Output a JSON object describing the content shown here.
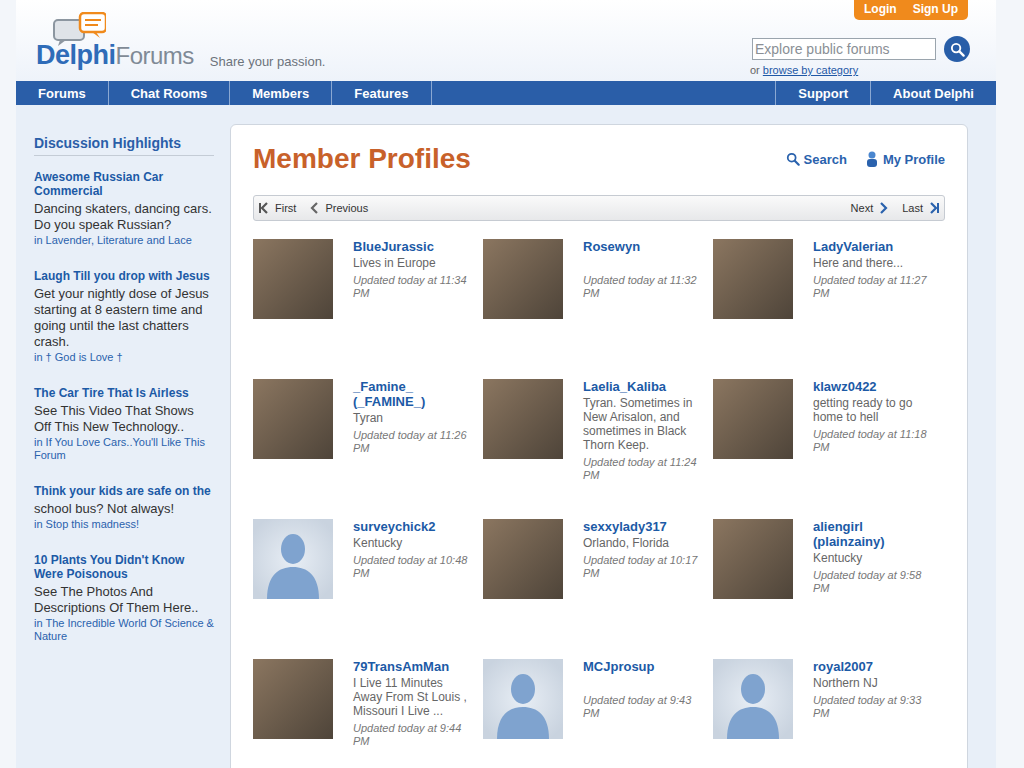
{
  "header": {
    "logo": {
      "first": "Delphi",
      "second": "Forums"
    },
    "tagline": "Share your passion.",
    "account_buttons": [
      "Login",
      "Sign Up"
    ],
    "search": {
      "placeholder": "Explore public forums",
      "alt_prefix": "or",
      "alt_link": "browse by category"
    }
  },
  "nav": {
    "left": [
      "Forums",
      "Chat Rooms",
      "Members",
      "Features"
    ],
    "right": [
      "Support",
      "About Delphi"
    ]
  },
  "sidebar": {
    "title": "Discussion Highlights",
    "items": [
      {
        "title": "Awesome Russian Car Commercial",
        "text": "Dancing skaters, dancing cars. Do you speak Russian?",
        "forum": "in Lavender, Literature and Lace"
      },
      {
        "title": "Laugh Till you drop with Jesus",
        "text": "Get your nightly dose of Jesus starting at 8 eastern time and going until the last chatters crash.",
        "forum": "in † God is Love †"
      },
      {
        "title": "The Car Tire That Is Airless",
        "text": "See This Video That Shows Off This New Technology..",
        "forum": "in If You Love Cars..You'll Like This Forum"
      },
      {
        "title": "Think your kids are safe on the",
        "text": "school bus? Not always!",
        "forum": "in Stop this madness!"
      },
      {
        "title": "10 Plants You Didn't Know Were Poisonous",
        "text": "See The Photos And Descriptions Of Them Here..",
        "forum": "in The Incredible World Of Science & Nature"
      }
    ]
  },
  "main": {
    "title": "Member Profiles",
    "actions": [
      {
        "label": "Search",
        "kind": "search"
      },
      {
        "label": "My Profile",
        "kind": "profile"
      }
    ],
    "pager": {
      "first": "First",
      "previous": "Previous",
      "next": "Next",
      "last": "Last"
    },
    "profiles": [
      {
        "name": "BlueJurassic",
        "location": "Lives in Europe",
        "updated": "Updated today at 11:34 PM",
        "avatar": "photo"
      },
      {
        "name": "Rosewyn",
        "location": "",
        "updated": "Updated today at 11:32 PM",
        "avatar": "photo"
      },
      {
        "name": "LadyValerian",
        "location": "Here and there...",
        "updated": "Updated today at 11:27 PM",
        "avatar": "photo"
      },
      {
        "name": "_Famine_ (_FAMINE_)",
        "location": "Tyran",
        "updated": "Updated today at 11:26 PM",
        "avatar": "photo"
      },
      {
        "name": "Laelia_Kaliba",
        "location": "Tyran. Sometimes in New Arisalon, and sometimes in Black Thorn Keep.",
        "updated": "Updated today at 11:24 PM",
        "avatar": "photo"
      },
      {
        "name": "klawz0422",
        "location": "getting ready to go home to hell",
        "updated": "Updated today at 11:18 PM",
        "avatar": "photo"
      },
      {
        "name": "surveychick2",
        "location": "Kentucky",
        "updated": "Updated today at 10:48 PM",
        "avatar": "default"
      },
      {
        "name": "sexxylady317",
        "location": "Orlando, Florida",
        "updated": "Updated today at 10:17 PM",
        "avatar": "photo"
      },
      {
        "name": "aliengirl (plainzainy)",
        "location": "Kentucky",
        "updated": "Updated today at 9:58 PM",
        "avatar": "photo"
      },
      {
        "name": "79TransAmMan",
        "location": "I Live 11 Minutes Away From St Louis , Missouri I Live ...",
        "updated": "Updated today at 9:44 PM",
        "avatar": "photo"
      },
      {
        "name": "MCJprosup",
        "location": "",
        "updated": "Updated today at 9:43 PM",
        "avatar": "default"
      },
      {
        "name": "royal2007",
        "location": "Northern NJ",
        "updated": "Updated today at 9:33 PM",
        "avatar": "default"
      }
    ]
  }
}
